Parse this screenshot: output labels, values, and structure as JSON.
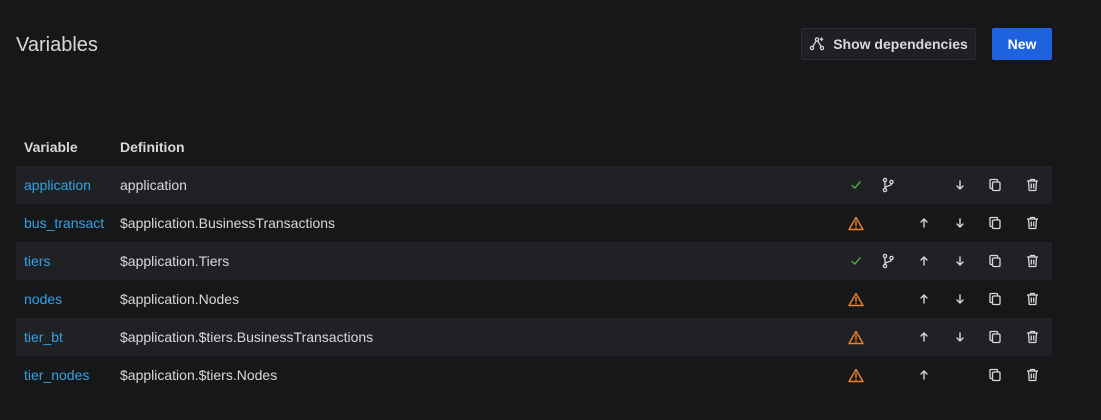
{
  "header": {
    "title": "Variables",
    "show_dependencies_label": "Show dependencies",
    "new_label": "New"
  },
  "table": {
    "columns": [
      "Variable",
      "Definition"
    ],
    "rows": [
      {
        "name": "application",
        "definition": "application",
        "status": "ok",
        "branch": true,
        "up": false,
        "down": true
      },
      {
        "name": "bus_transact",
        "definition": "$application.BusinessTransactions",
        "status": "warning",
        "branch": false,
        "up": true,
        "down": true
      },
      {
        "name": "tiers",
        "definition": "$application.Tiers",
        "status": "ok",
        "branch": true,
        "up": true,
        "down": true
      },
      {
        "name": "nodes",
        "definition": "$application.Nodes",
        "status": "warning",
        "branch": false,
        "up": true,
        "down": true
      },
      {
        "name": "tier_bt",
        "definition": "$application.$tiers.BusinessTransactions",
        "status": "warning",
        "branch": false,
        "up": true,
        "down": true
      },
      {
        "name": "tier_nodes",
        "definition": "$application.$tiers.Nodes",
        "status": "warning",
        "branch": false,
        "up": true,
        "down": false
      }
    ]
  },
  "colors": {
    "background": "#161719",
    "link": "#33a2e5",
    "ok": "#56a64b",
    "warning": "#f2822a",
    "primary": "#1f62e0"
  },
  "icons": {
    "status_ok": "check-icon",
    "status_warning": "warning-triangle-icon",
    "branch": "code-branch-icon",
    "up": "arrow-up-icon",
    "down": "arrow-down-icon",
    "duplicate": "copy-icon",
    "delete": "trash-icon",
    "dependencies": "graph-nodes-icon"
  }
}
